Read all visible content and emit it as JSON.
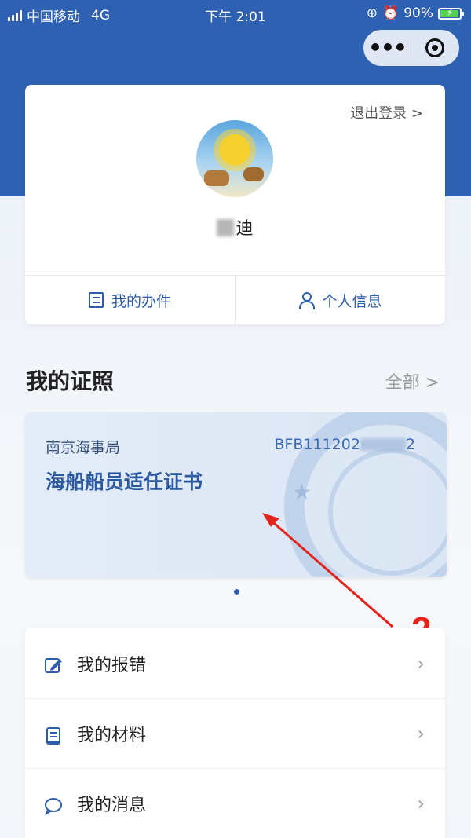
{
  "status_bar": {
    "carrier": "中国移动",
    "network": "4G",
    "time": "下午 2:01",
    "battery": "90%",
    "battery_level": 0.9
  },
  "profile": {
    "logout_label": "退出登录 >",
    "username_visible": "迪",
    "actions": [
      {
        "label": "我的办件",
        "icon": "document-list-icon"
      },
      {
        "label": "个人信息",
        "icon": "user-icon"
      }
    ]
  },
  "licenses": {
    "title": "我的证照",
    "view_all": "全部 >",
    "card": {
      "issuer": "南京海事局",
      "number": "BFB111202",
      "number_tail": "2",
      "name": "海船船员适任证书"
    }
  },
  "annotation": {
    "number": "2",
    "color": "#e4231a"
  },
  "menu": [
    {
      "label": "我的报错",
      "icon": "edit-icon"
    },
    {
      "label": "我的材料",
      "icon": "book-icon"
    },
    {
      "label": "我的消息",
      "icon": "chat-icon"
    }
  ],
  "colors": {
    "header_blue": "#2f61b3",
    "accent_blue": "#2e5ea9"
  }
}
